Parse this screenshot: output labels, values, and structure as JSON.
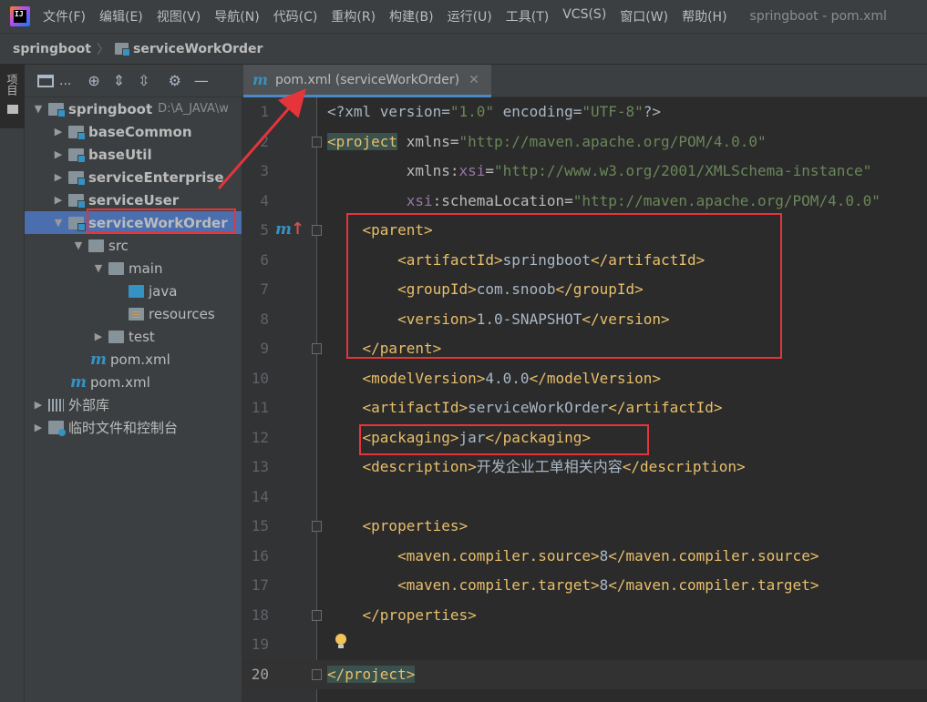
{
  "menubar": {
    "items": [
      "文件(F)",
      "编辑(E)",
      "视图(V)",
      "导航(N)",
      "代码(C)",
      "重构(R)",
      "构建(B)",
      "运行(U)",
      "工具(T)",
      "VCS(S)",
      "窗口(W)",
      "帮助(H)"
    ],
    "window_title": "springboot - pom.xml"
  },
  "breadcrumb": {
    "root": "springboot",
    "module": "serviceWorkOrder"
  },
  "side_strip": {
    "tab_label": "项目"
  },
  "project_panel": {
    "view_label": "...",
    "root": {
      "name": "springboot",
      "path": "D:\\A_JAVA\\w"
    },
    "modules": [
      "baseCommon",
      "baseUtil",
      "serviceEnterprise",
      "serviceUser"
    ],
    "selected_module": "serviceWorkOrder",
    "src": "src",
    "main": "main",
    "java": "java",
    "resources": "resources",
    "test": "test",
    "module_pom": "pom.xml",
    "root_pom": "pom.xml",
    "external_libs": "外部库",
    "scratches": "临时文件和控制台"
  },
  "editor_tab": {
    "label": "pom.xml (serviceWorkOrder)",
    "icon": "maven-m-icon"
  },
  "editor": {
    "lines": [
      {
        "n": "1",
        "parts": [
          [
            "pi",
            "<?xml version="
          ],
          [
            "str",
            "\"1.0\""
          ],
          [
            "pi",
            " encoding="
          ],
          [
            "str",
            "\"UTF-8\""
          ],
          [
            "pi",
            "?>"
          ]
        ]
      },
      {
        "n": "2",
        "parts": [
          [
            "tag-hl",
            "<project"
          ],
          [
            "attr",
            " xmlns="
          ],
          [
            "str",
            "\"http://maven.apache.org/POM/4.0.0\""
          ]
        ]
      },
      {
        "n": "3",
        "parts": [
          [
            "attr",
            "         xmlns:"
          ],
          [
            "ns",
            "xsi"
          ],
          [
            "attr",
            "="
          ],
          [
            "str",
            "\"http://www.w3.org/2001/XMLSchema-instance\""
          ]
        ]
      },
      {
        "n": "4",
        "parts": [
          [
            "ns",
            "         xsi"
          ],
          [
            "attr",
            ":schemaLocation="
          ],
          [
            "str",
            "\"http://maven.apache.org/POM/4.0.0\""
          ]
        ]
      },
      {
        "n": "5",
        "parts": [
          [
            "tag",
            "    <parent>"
          ]
        ]
      },
      {
        "n": "6",
        "parts": [
          [
            "tag",
            "        <artifactId>"
          ],
          [
            "txt",
            "springboot"
          ],
          [
            "tag",
            "</artifactId>"
          ]
        ]
      },
      {
        "n": "7",
        "parts": [
          [
            "tag",
            "        <groupId>"
          ],
          [
            "txt",
            "com.snoob"
          ],
          [
            "tag",
            "</groupId>"
          ]
        ]
      },
      {
        "n": "8",
        "parts": [
          [
            "tag",
            "        <version>"
          ],
          [
            "txt",
            "1.0-SNAPSHOT"
          ],
          [
            "tag",
            "</version>"
          ]
        ]
      },
      {
        "n": "9",
        "parts": [
          [
            "tag",
            "    </parent>"
          ]
        ]
      },
      {
        "n": "10",
        "parts": [
          [
            "tag",
            "    <modelVersion>"
          ],
          [
            "txt",
            "4.0.0"
          ],
          [
            "tag",
            "</modelVersion>"
          ]
        ]
      },
      {
        "n": "11",
        "parts": [
          [
            "tag",
            "    <artifactId>"
          ],
          [
            "txt",
            "serviceWorkOrder"
          ],
          [
            "tag",
            "</artifactId>"
          ]
        ]
      },
      {
        "n": "12",
        "parts": [
          [
            "tag",
            "    <packaging>"
          ],
          [
            "txt",
            "jar"
          ],
          [
            "tag",
            "</packaging>"
          ]
        ]
      },
      {
        "n": "13",
        "parts": [
          [
            "tag",
            "    <description>"
          ],
          [
            "txt",
            "开发企业工单相关内容"
          ],
          [
            "tag",
            "</description>"
          ]
        ]
      },
      {
        "n": "14",
        "parts": []
      },
      {
        "n": "15",
        "parts": [
          [
            "tag",
            "    <properties>"
          ]
        ]
      },
      {
        "n": "16",
        "parts": [
          [
            "tag",
            "        <maven.compiler.source>"
          ],
          [
            "txt",
            "8"
          ],
          [
            "tag",
            "</maven.compiler.source>"
          ]
        ]
      },
      {
        "n": "17",
        "parts": [
          [
            "tag",
            "        <maven.compiler.target>"
          ],
          [
            "txt",
            "8"
          ],
          [
            "tag",
            "</maven.compiler.target>"
          ]
        ]
      },
      {
        "n": "18",
        "parts": [
          [
            "tag",
            "    </properties>"
          ]
        ]
      },
      {
        "n": "19",
        "parts": []
      },
      {
        "n": "20",
        "parts": [
          [
            "tag-hl",
            "</project>"
          ]
        ]
      }
    ],
    "gutter_marker": "m",
    "current_line": "20"
  },
  "colors": {
    "annotation_red": "#e5343a",
    "selection_blue": "#4b6eaf",
    "xml_tag": "#e8bf6a",
    "xml_string": "#6a8759"
  }
}
